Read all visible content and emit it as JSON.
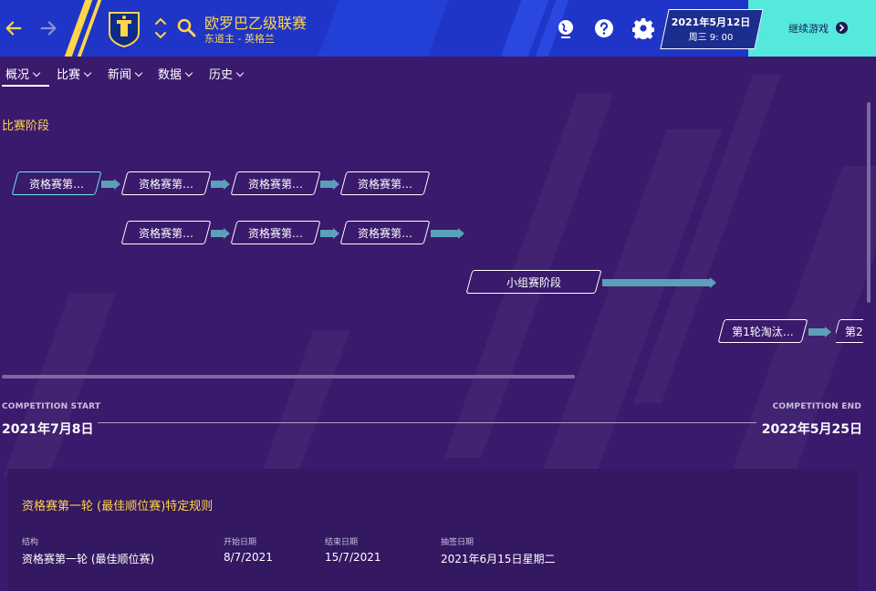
{
  "header": {
    "competition_title": "欧罗巴乙级联赛",
    "competition_sub": "东道主 - 英格兰",
    "date_line1": "2021年5月12日",
    "date_line2": "周三 9: 00",
    "continue_label": "继续游戏"
  },
  "tabs": [
    {
      "label": "概况"
    },
    {
      "label": "比赛"
    },
    {
      "label": "新闻"
    },
    {
      "label": "数据"
    },
    {
      "label": "历史"
    }
  ],
  "stages": {
    "title": "比赛阶段",
    "row1": [
      "资格赛第…",
      "资格赛第…",
      "资格赛第…",
      "资格赛第…"
    ],
    "row2": [
      "资格赛第…",
      "资格赛第…",
      "资格赛第…"
    ],
    "group": "小组赛阶段",
    "knockout1": "第1轮淘汰…",
    "knockout2": "第2"
  },
  "timeline": {
    "start_label": "COMPETITION START",
    "start_date": "2021年7月8日",
    "end_label": "COMPETITION END",
    "end_date": "2022年5月25日"
  },
  "rules": {
    "title": "资格赛第一轮 (最佳顺位赛)特定规则",
    "headers": [
      "结构",
      "开始日期",
      "结束日期",
      "抽签日期"
    ],
    "values": [
      "资格赛第一轮 (最佳顺位赛)",
      "8/7/2021",
      "15/7/2021",
      "2021年6月15日星期二"
    ]
  },
  "colors": {
    "background": "#3a1a6c",
    "header": "#1e35c8",
    "accent_yellow": "#ffd54a",
    "continue": "#55e8dd",
    "active_stage": "#6fe7f0"
  }
}
